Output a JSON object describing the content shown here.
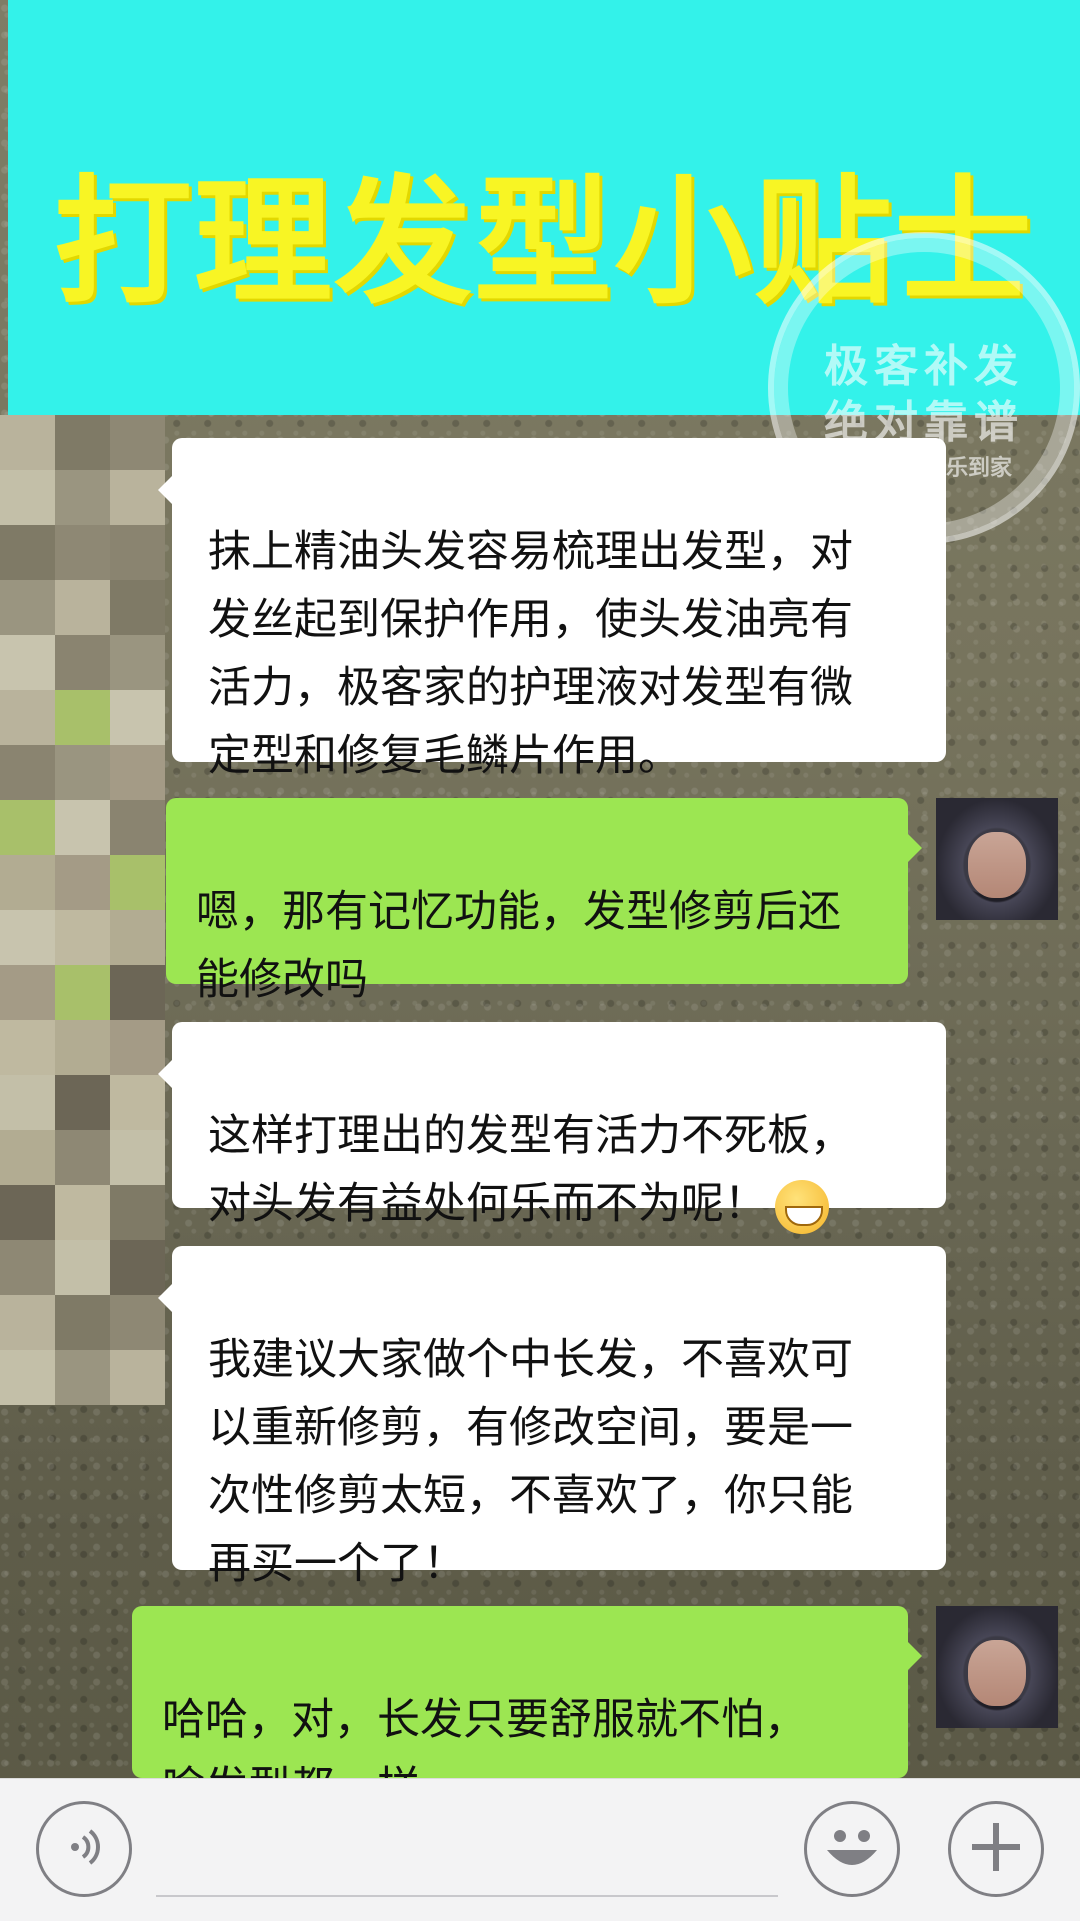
{
  "banner": {
    "title": "打理发型小贴士",
    "stamp_line1": "极客补发",
    "stamp_line2": "绝对靠谱",
    "stamp_line3": "上门补发快乐到家"
  },
  "messages": [
    {
      "side": "in",
      "text": "抹上精油头发容易梳理出发型，对\n发丝起到保护作用，使头发油亮有\n活力，极客家的护理液对发型有微\n定型和修复毛鳞片作用。"
    },
    {
      "side": "out",
      "text": "嗯，那有记忆功能，发型修剪后还\n能修改吗"
    },
    {
      "side": "in",
      "text": "这样打理出的发型有活力不死板，\n对头发有益处何乐而不为呢！"
    },
    {
      "side": "in",
      "text": "我建议大家做个中长发，不喜欢可\n以重新修剪，有修改空间，要是一\n次性修剪太短，不喜欢了，你只能\n再买一个了！"
    },
    {
      "side": "out",
      "text": "哈哈，对，长发只要舒服就不怕，\n啥发型都一样"
    }
  ],
  "icons": {
    "voice": "voice-icon",
    "emoji": "emoji-icon",
    "plus": "plus-icon",
    "grin": "grinning-emoji-icon"
  },
  "colors": {
    "banner_bg": "#33f2ea",
    "banner_text": "#f8f524",
    "incoming_bubble": "#ffffff",
    "outgoing_bubble": "#9ce652"
  }
}
